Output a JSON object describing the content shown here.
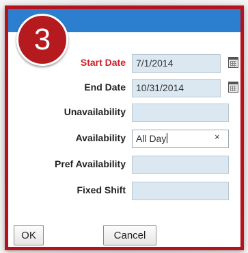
{
  "step_number": "3",
  "form": {
    "start_date": {
      "label": "Start Date",
      "value": "7/1/2014"
    },
    "end_date": {
      "label": "End Date",
      "value": "10/31/2014"
    },
    "unavailability": {
      "label": "Unavailability",
      "value": ""
    },
    "availability": {
      "label": "Availability",
      "value": "All Day",
      "clear_icon": "×"
    },
    "pref_availability": {
      "label": "Pref Availability",
      "value": ""
    },
    "fixed_shift": {
      "label": "Fixed Shift",
      "value": ""
    }
  },
  "buttons": {
    "ok_label": "OK",
    "cancel_label": "Cancel"
  },
  "colors": {
    "border": "#b5121b",
    "titlebar": "#2c7fce",
    "badge": "#b51a1f",
    "required_label": "#d0202b",
    "field_bg": "#dbe8f2"
  },
  "icons": {
    "date_picker": "calendar-icon",
    "clear": "clear-icon"
  }
}
